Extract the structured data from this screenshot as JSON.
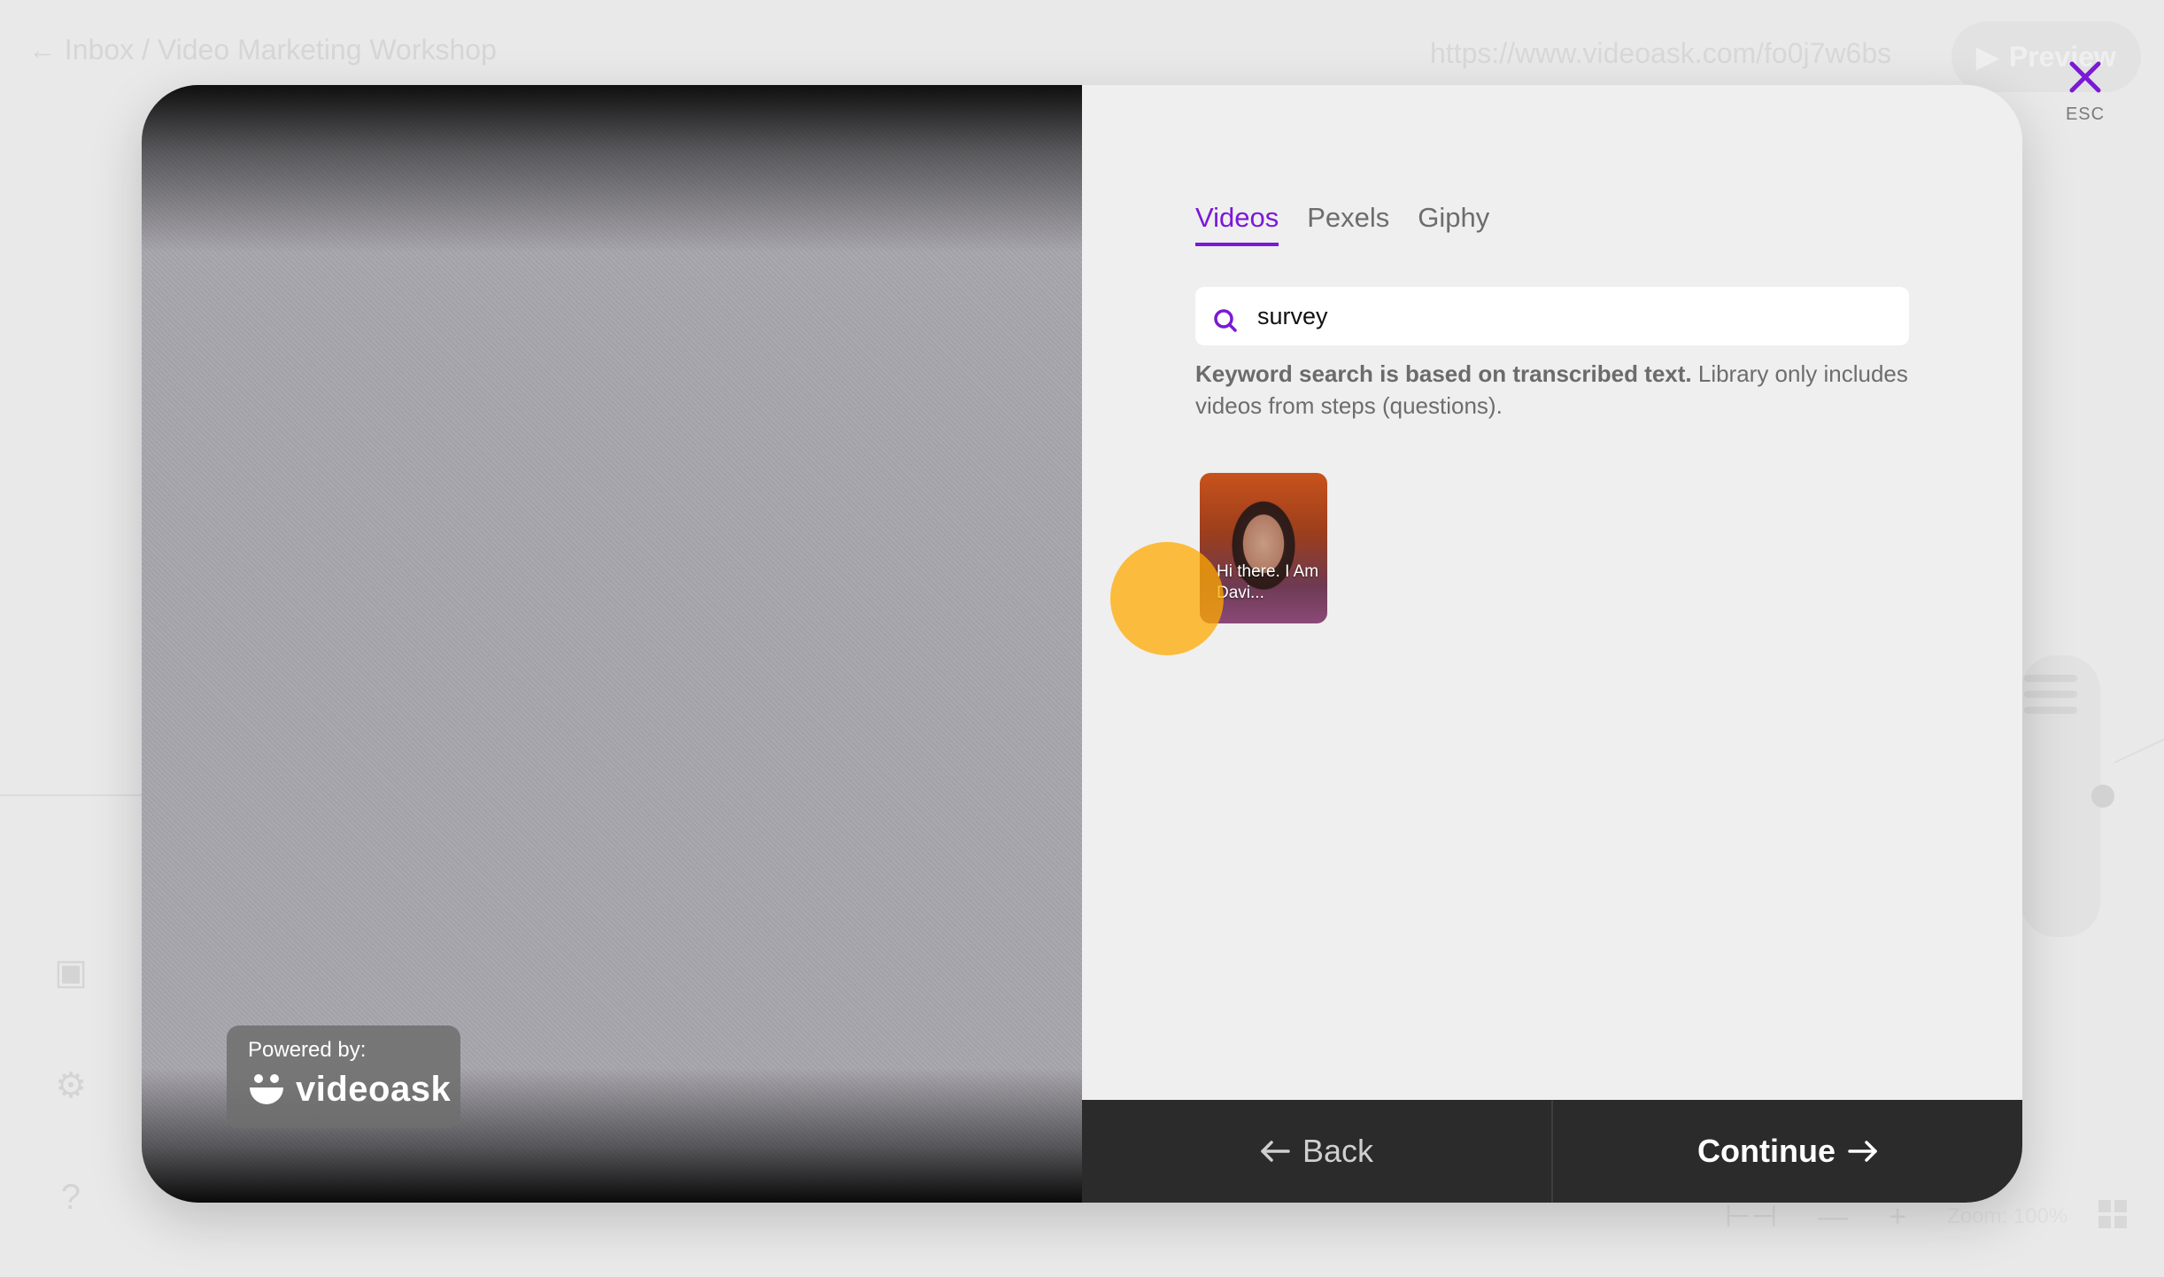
{
  "background": {
    "breadcrumb": "← Inbox / Video Marketing Workshop",
    "share_url": "https://www.videoask.com/fo0j7w6bs",
    "preview_label": "Preview",
    "zoom_text": "Zoom: 100%"
  },
  "close": {
    "label": "ESC",
    "icon": "close-icon",
    "color": "#7a19d6"
  },
  "video": {
    "powered_by_label": "Powered by:",
    "brand_name": "videoask"
  },
  "library": {
    "tabs": [
      {
        "label": "Videos",
        "active": true
      },
      {
        "label": "Pexels",
        "active": false
      },
      {
        "label": "Giphy",
        "active": false
      }
    ],
    "search": {
      "value": "survey",
      "icon": "search-icon"
    },
    "help_bold": "Keyword search is based on transcribed text.",
    "help_rest": " Library only includes videos from steps (questions).",
    "results": [
      {
        "caption": "Hi there. I Am Davi..."
      }
    ]
  },
  "footer": {
    "back_label": "Back",
    "continue_label": "Continue"
  },
  "colors": {
    "accent": "#7a19d6",
    "footer_bg": "#2b2b2b",
    "highlight": "#ffaa00"
  }
}
